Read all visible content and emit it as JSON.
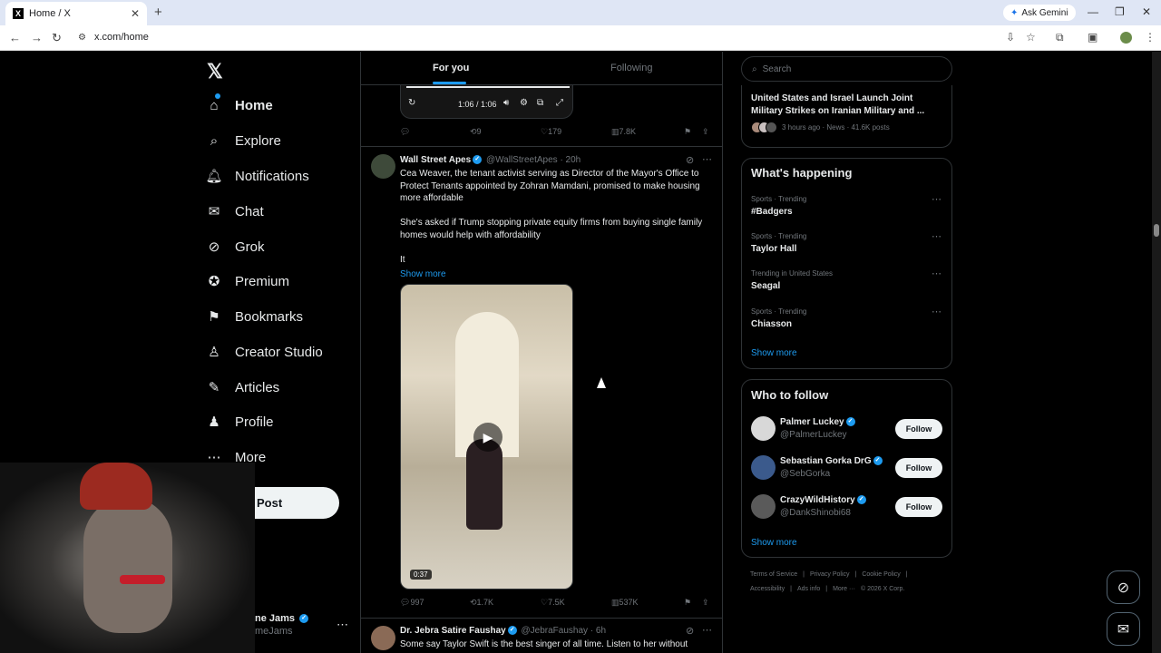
{
  "browser": {
    "tab_title": "Home / X",
    "tab_close": "✕",
    "new_tab": "+",
    "ask_gemini": "Ask Gemini",
    "url": "x.com/home"
  },
  "sidebar": {
    "logo": "𝕏",
    "items": [
      {
        "label": "Home",
        "icon": "⌂",
        "icon_name": "home-icon"
      },
      {
        "label": "Explore",
        "icon": "⌕",
        "icon_name": "search-icon"
      },
      {
        "label": "Notifications",
        "icon": "🔔︎",
        "icon_name": "bell-icon"
      },
      {
        "label": "Chat",
        "icon": "✉",
        "icon_name": "mail-icon"
      },
      {
        "label": "Grok",
        "icon": "⊘",
        "icon_name": "grok-icon"
      },
      {
        "label": "Premium",
        "icon": "✪",
        "icon_name": "premium-icon"
      },
      {
        "label": "Bookmarks",
        "icon": "⚑",
        "icon_name": "bookmark-icon"
      },
      {
        "label": "Creator Studio",
        "icon": "♙",
        "icon_name": "creator-studio-icon"
      },
      {
        "label": "Articles",
        "icon": "✎",
        "icon_name": "articles-icon"
      },
      {
        "label": "Profile",
        "icon": "♟",
        "icon_name": "person-icon"
      },
      {
        "label": "More",
        "icon": "⋯",
        "icon_name": "more-icon"
      }
    ],
    "post_label": "Post",
    "account_name": "ne Jams",
    "account_handle": "meJams",
    "account_more": "⋯"
  },
  "feed": {
    "tabs": [
      "For you",
      "Following"
    ],
    "prev_video_time": "1:06 / 1:06",
    "prev_actions": {
      "reply": "",
      "repost": "9",
      "like": "179",
      "views": "7.8K"
    },
    "tweet1": {
      "name": "Wall Street Apes",
      "handle": "@WallStreetApes",
      "time": "· 20h",
      "text": "Cea Weaver, the tenant activist serving as Director of the Mayor's Office to Protect Tenants appointed by Zohran Mamdani, promised to make housing more affordable\n\nShe's asked if Trump stopping private equity firms from buying single family homes would help with affordability\n\nIt",
      "show_more": "Show more",
      "video_duration": "0:37",
      "actions": {
        "reply": "997",
        "repost": "1.7K",
        "like": "7.5K",
        "views": "537K"
      }
    },
    "tweet2": {
      "name": "Dr. Jebra Satire Faushay",
      "handle": "@JebraFaushay",
      "time": "· 6h",
      "text": "Some say Taylor Swift is the best singer of all time. Listen to her without"
    }
  },
  "right": {
    "search_placeholder": "Search",
    "news": {
      "title": "United States and Israel Launch Joint Military Strikes on Iranian Military and ...",
      "meta": "3 hours ago · News · 41.6K posts"
    },
    "happening_title": "What's happening",
    "trends": [
      {
        "context": "Sports · Trending",
        "topic": "#Badgers"
      },
      {
        "context": "Sports · Trending",
        "topic": "Taylor Hall"
      },
      {
        "context": "Trending in United States",
        "topic": "Seagal"
      },
      {
        "context": "Sports · Trending",
        "topic": "Chiasson"
      }
    ],
    "trends_show_more": "Show more",
    "who_title": "Who to follow",
    "who": [
      {
        "name": "Palmer Luckey",
        "handle": "@PalmerLuckey",
        "follow": "Follow"
      },
      {
        "name": "Sebastian Gorka DrG",
        "handle": "@SebGorka",
        "follow": "Follow"
      },
      {
        "name": "CrazyWildHistory",
        "handle": "@DankShinobi68",
        "follow": "Follow"
      }
    ],
    "who_show_more": "Show more",
    "footer": [
      "Terms of Service",
      "|",
      "Privacy Policy",
      "|",
      "Cookie Policy",
      "|",
      "Accessibility",
      "|",
      "Ads info",
      "|",
      "More ···",
      "© 2026 X Corp."
    ]
  },
  "colors": {
    "accent": "#1d9bf0",
    "background": "#000000",
    "text": "#e7e9ea",
    "muted": "#71767b"
  }
}
